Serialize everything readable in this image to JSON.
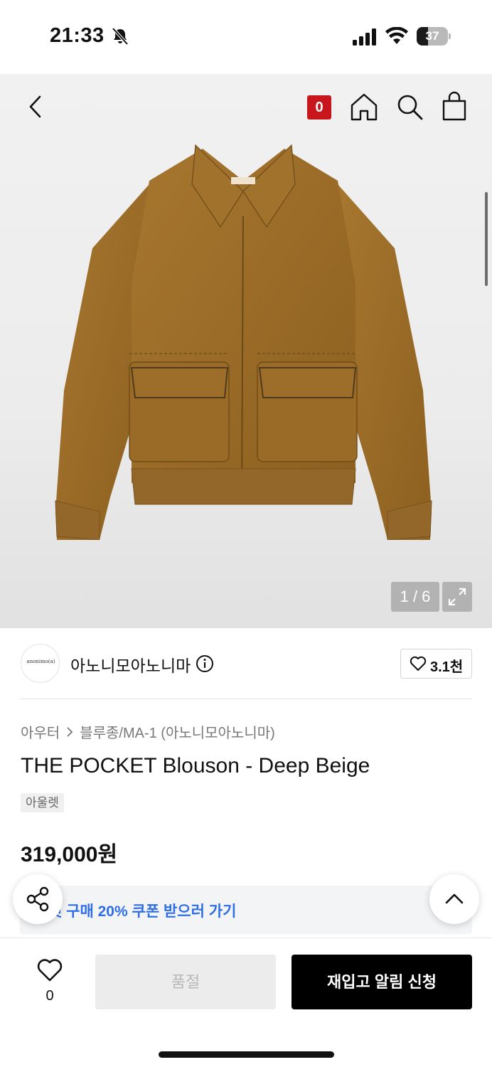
{
  "status_bar": {
    "time": "21:33",
    "battery_level": "37",
    "battery_fraction": 0.37,
    "icons": [
      "bell-muted-icon",
      "cellular-signal-icon",
      "wifi-icon",
      "battery-icon"
    ]
  },
  "header": {
    "cart_count": "0",
    "icons": [
      "back-chevron-icon",
      "home-icon",
      "search-icon",
      "shopping-bag-icon"
    ]
  },
  "gallery": {
    "page_indicator": "1 / 6",
    "current_index": 1,
    "total_images": 6,
    "image_label": "anonimo(a)"
  },
  "brand": {
    "logo_text": "anonimo(a)",
    "name": "아노니모아노니마",
    "like_count": "3.1천"
  },
  "product": {
    "breadcrumb": [
      "아우터",
      "블루종/MA-1 (아노니모아노니마)"
    ],
    "title": "THE POCKET Blouson - Deep Beige",
    "tag": "아울렛",
    "price": "319,000원"
  },
  "coupon": {
    "text": "첫 구매 20% 쿠폰 받으러 가기"
  },
  "bottom_bar": {
    "wish_count": "0",
    "soldout_label": "품절",
    "restock_label": "재입고 알림 신청"
  },
  "colors": {
    "cart_badge": "#c8161d",
    "coupon_text": "#2f6ee5",
    "jacket": "#9a6b27",
    "primary_button": "#000000"
  }
}
